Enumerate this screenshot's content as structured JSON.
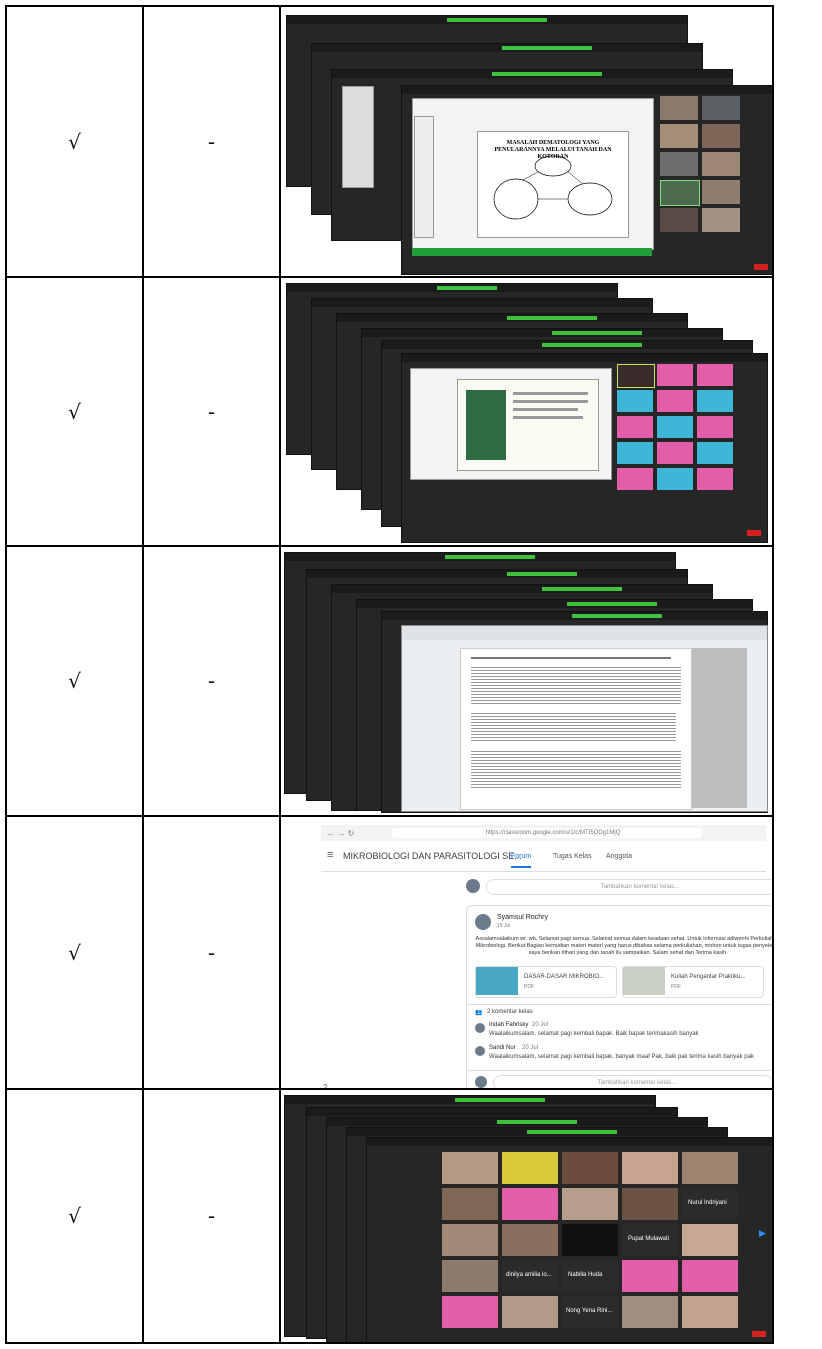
{
  "rows": [
    {
      "check": "√",
      "dash": "-",
      "shot": {
        "kind": "zoom-slides",
        "slide_title": "MASALAH DEMATOLOGI YANG PENULARANNYA MELALUI TANAH DAN KOTORAN"
      }
    },
    {
      "check": "√",
      "dash": "-",
      "shot": {
        "kind": "zoom-slides",
        "slide_title": ""
      }
    },
    {
      "check": "√",
      "dash": "-",
      "shot": {
        "kind": "zoom-pdf"
      }
    },
    {
      "check": "√",
      "dash": "-",
      "shot": {
        "kind": "classroom",
        "url": "https://classroom.google.com/u/1/c/MTI5ODg1MjQ",
        "course": "MIKROBIOLOGI DAN PARASITOLOGI SE...",
        "tabs": [
          "Forum",
          "Tugas Kelas",
          "Anggota"
        ],
        "top_comment_placeholder": "Tambahkan komentar kelas...",
        "author": "Syamsul Rochry",
        "date": "19 Jul",
        "message": "Assalamualaikum wr. wb, Selamat pagi semua. Selamat semua dalam keadaan sehat. Untuk informasi adiwenhi Perkuliahan Mikrobiologi. Berikut Bagian kemudian materi materi yang harus dibahas selama perkuliahan, mohon untuk tugas penyelesai saya berikan dihari yang dan tanah ilu sampaikan. Salam sehat dan Terima kasih",
        "attachments": [
          {
            "name": "DASAR-DASAR MIKROBIO...",
            "type": "PDF"
          },
          {
            "name": "Kuliah Pengantar Praktiku...",
            "type": "PDF"
          }
        ],
        "comments_count": "2 komentar kelas",
        "comments": [
          {
            "name": "Indah Fahrisky",
            "date": "20 Jul",
            "text": "Waalaikumsalam, selamat pagi kembali bapak. Baik bapak terimakasih banyak"
          },
          {
            "name": "Sandi Nur",
            "date": "20 Jul",
            "text": "Waalaikumsalam, selamat pagi kembali bapak, banyak maaf Pak, baik pak terima kasih banyak pak"
          }
        ],
        "bottom_comment_placeholder": "Tambahkan komentar kelas...",
        "help_icon": "?"
      }
    },
    {
      "check": "√",
      "dash": "-",
      "shot": {
        "kind": "zoom-gallery",
        "names": [
          "Nurul Indriyani",
          "Pupat Mulawati",
          "dinilya amilia lo...",
          "Nabilla Huda",
          "Nong Yena Rini..."
        ]
      }
    }
  ]
}
